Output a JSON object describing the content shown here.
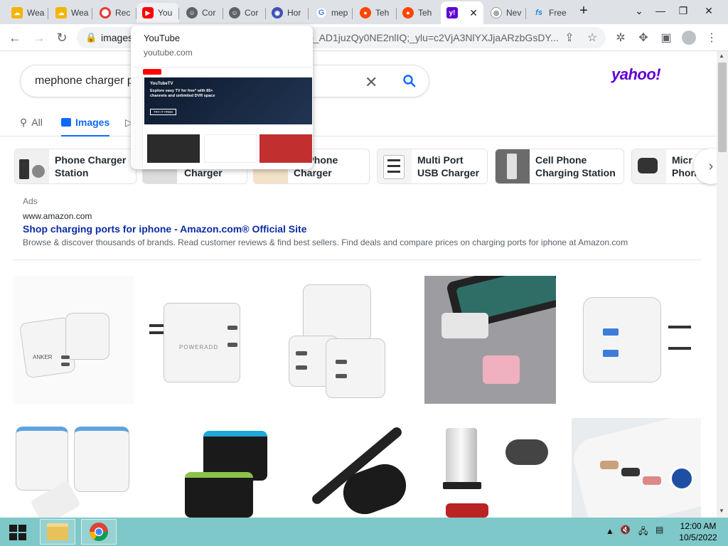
{
  "browser": {
    "tabs": [
      {
        "title": "Wea",
        "icon": "weather-icon"
      },
      {
        "title": "Wea",
        "icon": "weather-icon"
      },
      {
        "title": "Rec",
        "icon": "record-icon"
      },
      {
        "title": "You",
        "icon": "youtube-icon"
      },
      {
        "title": "Cor",
        "icon": "cor-icon"
      },
      {
        "title": "Cor",
        "icon": "cor-icon"
      },
      {
        "title": "Hor",
        "icon": "hor-icon"
      },
      {
        "title": "mep",
        "icon": "google-icon"
      },
      {
        "title": "Teh",
        "icon": "reddit-icon"
      },
      {
        "title": "Teh",
        "icon": "reddit-icon"
      },
      {
        "title": "",
        "icon": "yahoo-icon",
        "active": true
      },
      {
        "title": "Nev",
        "icon": "chrome-icon"
      },
      {
        "title": "Free",
        "icon": "fs-icon"
      }
    ],
    "new_tab_label": "+",
    "address": {
      "url_start": "images",
      "url_end": "sb_AD1juzQy0NE2nlIQ;_ylu=c2VjA3NlYXJjaARzbGsDY..."
    },
    "hover_card": {
      "title": "YouTube",
      "domain": "youtube.com",
      "preview_banner_brand": "YouTubeTV",
      "preview_banner_text": "Explore easy TV for free* with 85+ channels and unlimited DVR space",
      "preview_button": "TRY IT FREE"
    }
  },
  "search": {
    "query": "mephone charger p",
    "logo": "yahoo!",
    "tabs": [
      {
        "label": "All",
        "icon": "search-icon"
      },
      {
        "label": "Images",
        "icon": "image-icon",
        "active": true
      },
      {
        "label": "",
        "icon": "video-icon"
      }
    ]
  },
  "suggestions": [
    {
      "line1": "Phone Charger",
      "line2": "Station"
    },
    {
      "line1": "",
      "line2": "Charger"
    },
    {
      "line1": "ile Phone",
      "line2": "Charger"
    },
    {
      "line1": "Multi Port",
      "line2": "USB Charger"
    },
    {
      "line1": "Cell Phone",
      "line2": "Charging Station"
    },
    {
      "line1": "Micr",
      "line2": "Phon"
    }
  ],
  "ad": {
    "label": "Ads",
    "url": "www.amazon.com",
    "title": "Shop charging ports for iphone - Amazon.com® Official Site",
    "description": "Browse & discover thousands of brands. Read customer reviews & find best sellers. Find deals and compare prices on charging ports for iphone at Amazon.com"
  },
  "images": [
    {
      "brand": "ANKER"
    },
    {
      "brand": "POWERADD"
    },
    {
      "brand": ""
    },
    {
      "brand": ""
    },
    {
      "brand": ""
    },
    {
      "brand": ""
    },
    {
      "brand": ""
    },
    {
      "brand": ""
    },
    {
      "brand": ""
    },
    {
      "brand": ""
    }
  ],
  "taskbar": {
    "time": "12:00 AM",
    "date": "10/5/2022"
  },
  "colors": {
    "yahoo_purple": "#6001d2",
    "accent_blue": "#0f69ff",
    "taskbar": "#7fc8c9"
  }
}
